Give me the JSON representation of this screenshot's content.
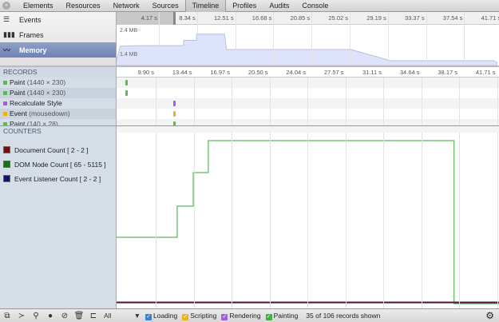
{
  "tabs": [
    "Elements",
    "Resources",
    "Network",
    "Sources",
    "Timeline",
    "Profiles",
    "Audits",
    "Console"
  ],
  "active_tab": "Timeline",
  "overview": {
    "items": [
      {
        "label": "Events",
        "icon": "events-icon"
      },
      {
        "label": "Frames",
        "icon": "frames-icon"
      },
      {
        "label": "Memory",
        "icon": "memory-icon"
      }
    ],
    "ruler": [
      "4.17 s",
      "8.34 s",
      "12.51 s",
      "16.68 s",
      "20.85 s",
      "25.02 s",
      "29.19 s",
      "33.37 s",
      "37.54 s",
      "41.71 s"
    ],
    "mem_max_label": "2.4 MB",
    "mem_min_label": "1.4 MB",
    "memory_mb": [
      [
        6.2,
        1.4
      ],
      [
        6.6,
        2.1
      ],
      [
        8.3,
        2.12
      ],
      [
        12.5,
        2.12
      ],
      [
        12.5,
        2.35
      ],
      [
        13.7,
        2.35
      ],
      [
        13.7,
        2.62
      ],
      [
        16.3,
        2.62
      ],
      [
        16.5,
        1.95
      ],
      [
        28.1,
        1.95
      ],
      [
        31.8,
        1.47
      ],
      [
        41.4,
        1.47
      ],
      [
        41.7,
        1.4
      ]
    ]
  },
  "records": {
    "title": "RECORDS",
    "ruler": [
      "9.90 s",
      "13.44 s",
      "16.97 s",
      "20.50 s",
      "24.04 s",
      "27.57 s",
      "31.11 s",
      "34.64 s",
      "38.17 s",
      "41.71 s"
    ],
    "rows": [
      {
        "name": "Paint",
        "detail": "(1440 × 230)",
        "color": "#5cb85c",
        "t": 6.9
      },
      {
        "name": "Paint",
        "detail": "(1440 × 230)",
        "color": "#5cb85c",
        "t": 6.9
      },
      {
        "name": "Recalculate Style",
        "detail": "",
        "color": "#a35ee0",
        "t": 11.4
      },
      {
        "name": "Event",
        "detail": "(mousedown)",
        "color": "#e8b416",
        "t": 11.4
      },
      {
        "name": "Paint",
        "detail": "(140 × 28)",
        "color": "#5cb85c",
        "t": 11.4
      }
    ]
  },
  "counters": {
    "title": "COUNTERS",
    "items": [
      {
        "label": "Document Count [ 2 - 2 ]",
        "color": "#7a0d0d"
      },
      {
        "label": "DOM Node Count [ 65 - 5115 ]",
        "color": "#0a7a0a"
      },
      {
        "label": "Event Listener Count [ 2 - 2 ]",
        "color": "#141470"
      }
    ],
    "dom_nodes": [
      [
        6.2,
        2120
      ],
      [
        11.9,
        2120
      ],
      [
        11.9,
        3085
      ],
      [
        13.4,
        3085
      ],
      [
        13.4,
        4125
      ],
      [
        14.8,
        4125
      ],
      [
        14.8,
        5115
      ],
      [
        37.7,
        5115
      ],
      [
        37.7,
        65
      ],
      [
        41.9,
        65
      ]
    ]
  },
  "status": {
    "filter": "All",
    "categories": [
      {
        "label": "Loading",
        "color": "#3a7fd5"
      },
      {
        "label": "Scripting",
        "color": "#e8b416"
      },
      {
        "label": "Rendering",
        "color": "#a35ee0"
      },
      {
        "label": "Painting",
        "color": "#3cb43c"
      }
    ],
    "records_shown": "35 of 106 records shown"
  }
}
